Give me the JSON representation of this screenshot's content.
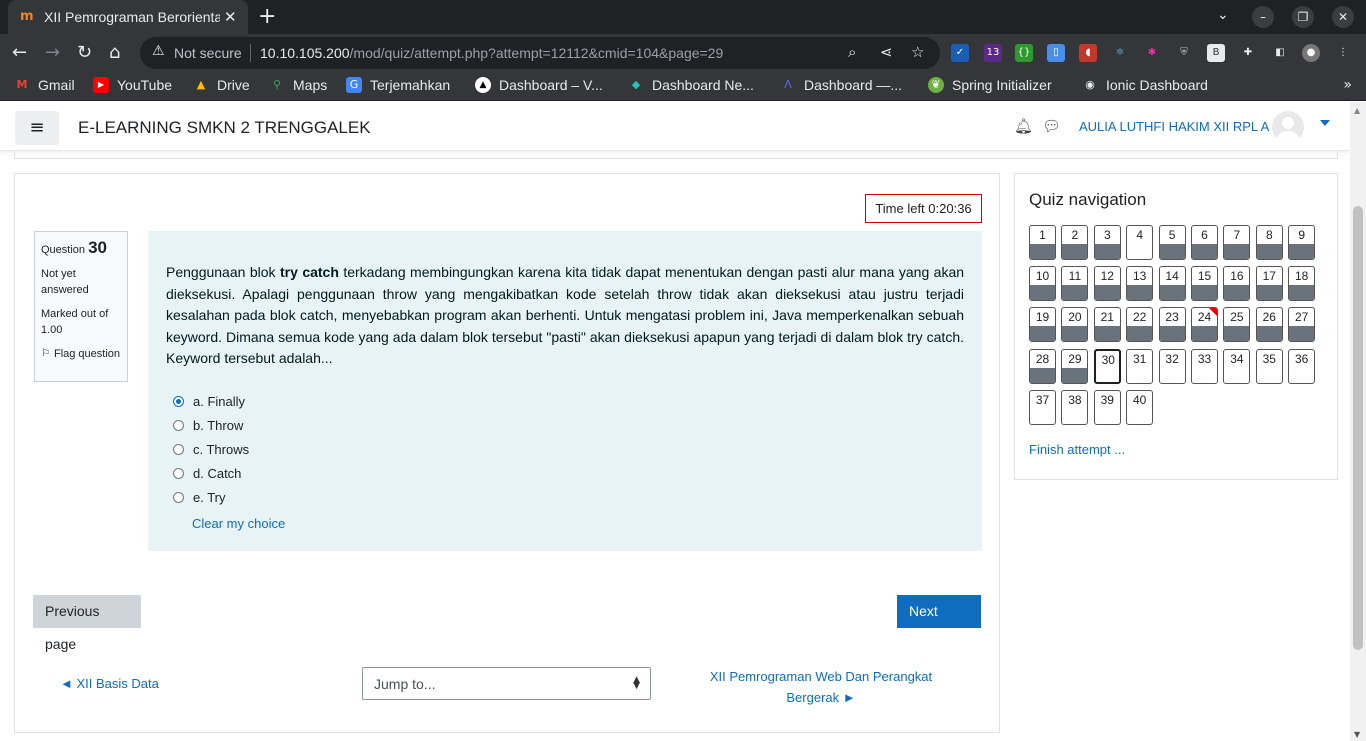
{
  "browser": {
    "tab_title": "XII Pemrograman Berorientasi Objek",
    "tab_close": "✕",
    "new_tab": "+",
    "not_secure": "Not secure",
    "url_host": "10.10.105.200",
    "url_path": "/mod/quiz/attempt.php?attempt=12112&cmid=104&page=29",
    "ext_badge": "13"
  },
  "bookmarks": [
    {
      "label": "Gmail",
      "icon": "gmail-icon"
    },
    {
      "label": "YouTube",
      "icon": "youtube-icon"
    },
    {
      "label": "Drive",
      "icon": "drive-icon"
    },
    {
      "label": "Maps",
      "icon": "maps-icon"
    },
    {
      "label": "Terjemahkan",
      "icon": "translate-icon"
    },
    {
      "label": "Dashboard – V...",
      "icon": "vercel-icon"
    },
    {
      "label": "Dashboard Ne...",
      "icon": "netlify-icon"
    },
    {
      "label": "Dashboard —...",
      "icon": "dashboard-icon"
    },
    {
      "label": "Spring Initializer",
      "icon": "spring-icon"
    },
    {
      "label": "Ionic Dashboard",
      "icon": "ionic-icon"
    }
  ],
  "header": {
    "site_name": "E-LEARNING SMKN 2 TRENGGALEK",
    "user_name": "AULIA LUTHFI HAKIM XII RPL A"
  },
  "quiz": {
    "time_left": "Time left 0:20:36",
    "question_label": "Question",
    "question_number": "30",
    "status": "Not yet answered",
    "marked_out_of": "Marked out of 1.00",
    "flag_label": "Flag question",
    "question_text_before": "Penggunaan blok ",
    "question_bold": "try catch",
    "question_text_after": " terkadang membingungkan karena kita tidak dapat menentukan dengan pasti alur mana yang akan dieksekusi. Apalagi penggunaan throw yang mengakibatkan kode setelah throw tidak akan dieksekusi atau justru terjadi kesalahan pada blok catch, menyebabkan program akan berhenti. Untuk mengatasi problem ini, Java memperkenalkan sebuah keyword. Dimana semua kode yang ada dalam blok tersebut \"pasti\" akan dieksekusi apapun yang terjadi di dalam blok try catch. Keyword tersebut adalah...",
    "answers": [
      {
        "label": "a. Finally",
        "selected": true
      },
      {
        "label": "b. Throw",
        "selected": false
      },
      {
        "label": "c. Throws",
        "selected": false
      },
      {
        "label": "d. Catch",
        "selected": false
      },
      {
        "label": "e. Try",
        "selected": false
      }
    ],
    "clear_choice": "Clear my choice",
    "prev_page": "Previous page",
    "next_page": "Next page",
    "prev_activity": "◄ XII Basis Data",
    "jump_to": "Jump to...",
    "next_activity": "XII Pemrograman Web Dan Perangkat Bergerak ►"
  },
  "quiz_nav": {
    "title": "Quiz navigation",
    "finish": "Finish attempt ...",
    "questions": [
      {
        "n": "1",
        "answered": true
      },
      {
        "n": "2",
        "answered": true
      },
      {
        "n": "3",
        "answered": true
      },
      {
        "n": "4",
        "answered": false
      },
      {
        "n": "5",
        "answered": true
      },
      {
        "n": "6",
        "answered": true
      },
      {
        "n": "7",
        "answered": true
      },
      {
        "n": "8",
        "answered": true
      },
      {
        "n": "9",
        "answered": true
      },
      {
        "n": "10",
        "answered": true
      },
      {
        "n": "11",
        "answered": true
      },
      {
        "n": "12",
        "answered": true
      },
      {
        "n": "13",
        "answered": true
      },
      {
        "n": "14",
        "answered": true
      },
      {
        "n": "15",
        "answered": true
      },
      {
        "n": "16",
        "answered": true
      },
      {
        "n": "17",
        "answered": true
      },
      {
        "n": "18",
        "answered": true
      },
      {
        "n": "19",
        "answered": true
      },
      {
        "n": "20",
        "answered": true
      },
      {
        "n": "21",
        "answered": true
      },
      {
        "n": "22",
        "answered": true
      },
      {
        "n": "23",
        "answered": true
      },
      {
        "n": "24",
        "answered": true,
        "flagged": true
      },
      {
        "n": "25",
        "answered": true
      },
      {
        "n": "26",
        "answered": true
      },
      {
        "n": "27",
        "answered": true
      },
      {
        "n": "28",
        "answered": true
      },
      {
        "n": "29",
        "answered": true
      },
      {
        "n": "30",
        "answered": false,
        "current": true
      },
      {
        "n": "31",
        "answered": false
      },
      {
        "n": "32",
        "answered": false
      },
      {
        "n": "33",
        "answered": false
      },
      {
        "n": "34",
        "answered": false
      },
      {
        "n": "35",
        "answered": false
      },
      {
        "n": "36",
        "answered": false
      },
      {
        "n": "37",
        "answered": false
      },
      {
        "n": "38",
        "answered": false
      },
      {
        "n": "39",
        "answered": false
      },
      {
        "n": "40",
        "answered": false
      }
    ]
  },
  "colors": {
    "accent": "#0f6cbf",
    "answered": "#6a737b",
    "timer_border": "#cc0000",
    "question_bg": "#e7f3f5"
  }
}
